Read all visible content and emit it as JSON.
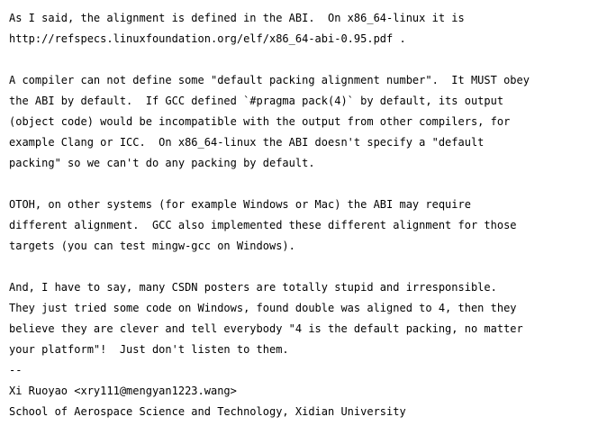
{
  "paragraphs": [
    {
      "lines": [
        "As I said, the alignment is defined in the ABI.  On x86_64-linux it is",
        "http://refspecs.linuxfoundation.org/elf/x86_64-abi-0.95.pdf ."
      ]
    },
    {
      "lines": [
        "A compiler can not define some \"default packing alignment number\".  It MUST obey",
        "the ABI by default.  If GCC defined `#pragma pack(4)` by default, its output",
        "(object code) would be incompatible with the output from other compilers, for",
        "example Clang or ICC.  On x86_64-linux the ABI doesn't specify a \"default",
        "packing\" so we can't do any packing by default."
      ]
    },
    {
      "lines": [
        "OTOH, on other systems (for example Windows or Mac) the ABI may require",
        "different alignment.  GCC also implemented these different alignment for those",
        "targets (you can test mingw-gcc on Windows)."
      ]
    },
    {
      "lines": [
        "And, I have to say, many CSDN posters are totally stupid and irresponsible.",
        "They just tried some code on Windows, found double was aligned to 4, then they",
        "believe they are clever and tell everybody \"4 is the default packing, no matter",
        "your platform\"!  Just don't listen to them."
      ]
    }
  ],
  "signature": {
    "separator": "--",
    "name_email": "Xi Ruoyao <xry111@mengyan1223.wang>",
    "affiliation": "School of Aerospace Science and Technology, Xidian University"
  }
}
